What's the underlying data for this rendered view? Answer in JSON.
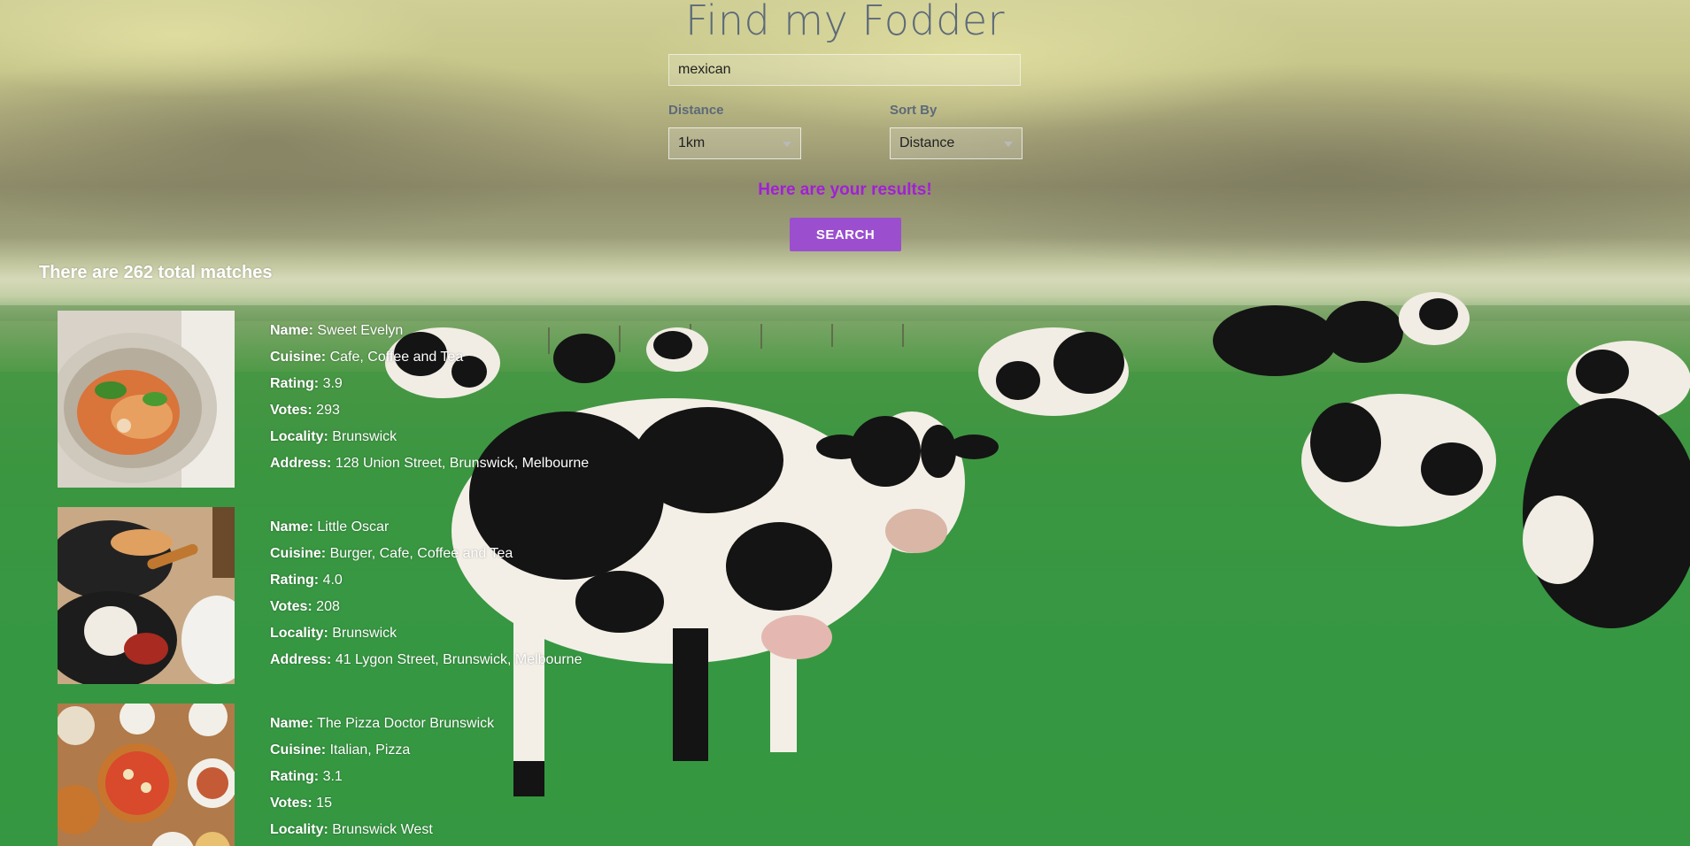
{
  "app": {
    "title": "Find my Fodder"
  },
  "search": {
    "value": "mexican"
  },
  "filters": {
    "distance": {
      "label": "Distance",
      "selected": "1km"
    },
    "sort_by": {
      "label": "Sort By",
      "selected": "Distance"
    }
  },
  "status": {
    "results_message": "Here are your results!"
  },
  "buttons": {
    "search": "SEARCH"
  },
  "results": {
    "summary": "There are 262 total matches",
    "field_labels": {
      "name": "Name:",
      "cuisine": "Cuisine:",
      "rating": "Rating:",
      "votes": "Votes:",
      "locality": "Locality:",
      "address": "Address:"
    },
    "items": [
      {
        "name": "Sweet Evelyn",
        "cuisine": "Cafe, Coffee and Tea",
        "rating": "3.9",
        "votes": "293",
        "locality": "Brunswick",
        "address": "128 Union Street, Brunswick, Melbourne"
      },
      {
        "name": "Little Oscar",
        "cuisine": "Burger, Cafe, Coffee and Tea",
        "rating": "4.0",
        "votes": "208",
        "locality": "Brunswick",
        "address": "41 Lygon Street, Brunswick, Melbourne"
      },
      {
        "name": "The Pizza Doctor Brunswick",
        "cuisine": "Italian, Pizza",
        "rating": "3.1",
        "votes": "15",
        "locality": "Brunswick West"
      }
    ]
  },
  "colors": {
    "accent": "#9b4fce",
    "message": "#a21fd6",
    "title": "#5d6a79"
  }
}
